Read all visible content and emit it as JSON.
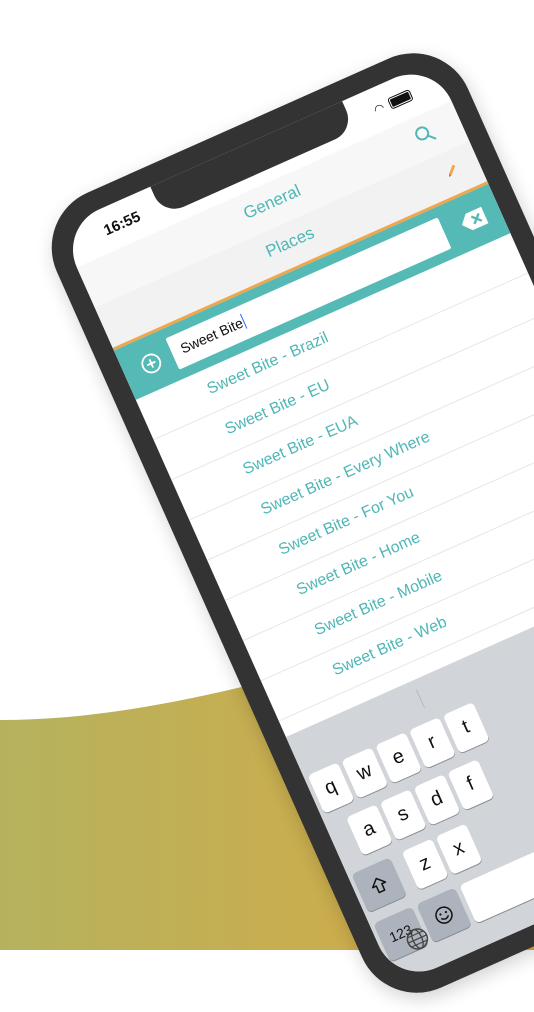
{
  "status": {
    "time": "16:55"
  },
  "nav": {
    "title": "General"
  },
  "subbar": {
    "title": "Places"
  },
  "search": {
    "value": "Sweet Bite"
  },
  "results": [
    "Sweet Bite - Brazil",
    "Sweet Bite - EU",
    "Sweet Bite - EUA",
    "Sweet Bite - Every Where",
    "Sweet Bite - For You",
    "Sweet Bite - Home",
    "Sweet Bite - Mobile",
    "Sweet Bite - Web"
  ],
  "keyboard": {
    "row1": [
      "q",
      "w",
      "e",
      "r",
      "t"
    ],
    "row2": [
      "a",
      "s",
      "d",
      "f"
    ],
    "row3": [
      "z",
      "x"
    ],
    "numbers_label": "123"
  },
  "colors": {
    "accent": "#4fb7b6",
    "search_bar": "#55b9b5",
    "divider": "#f0a64a",
    "frame": "#333333",
    "wave_start": "#b5b25e",
    "wave_end": "#d8aa44"
  },
  "icons": [
    "search-icon",
    "pencil-icon",
    "add-icon",
    "clear-icon",
    "shift-icon",
    "emoji-icon",
    "globe-icon",
    "wifi-icon",
    "battery-icon"
  ]
}
